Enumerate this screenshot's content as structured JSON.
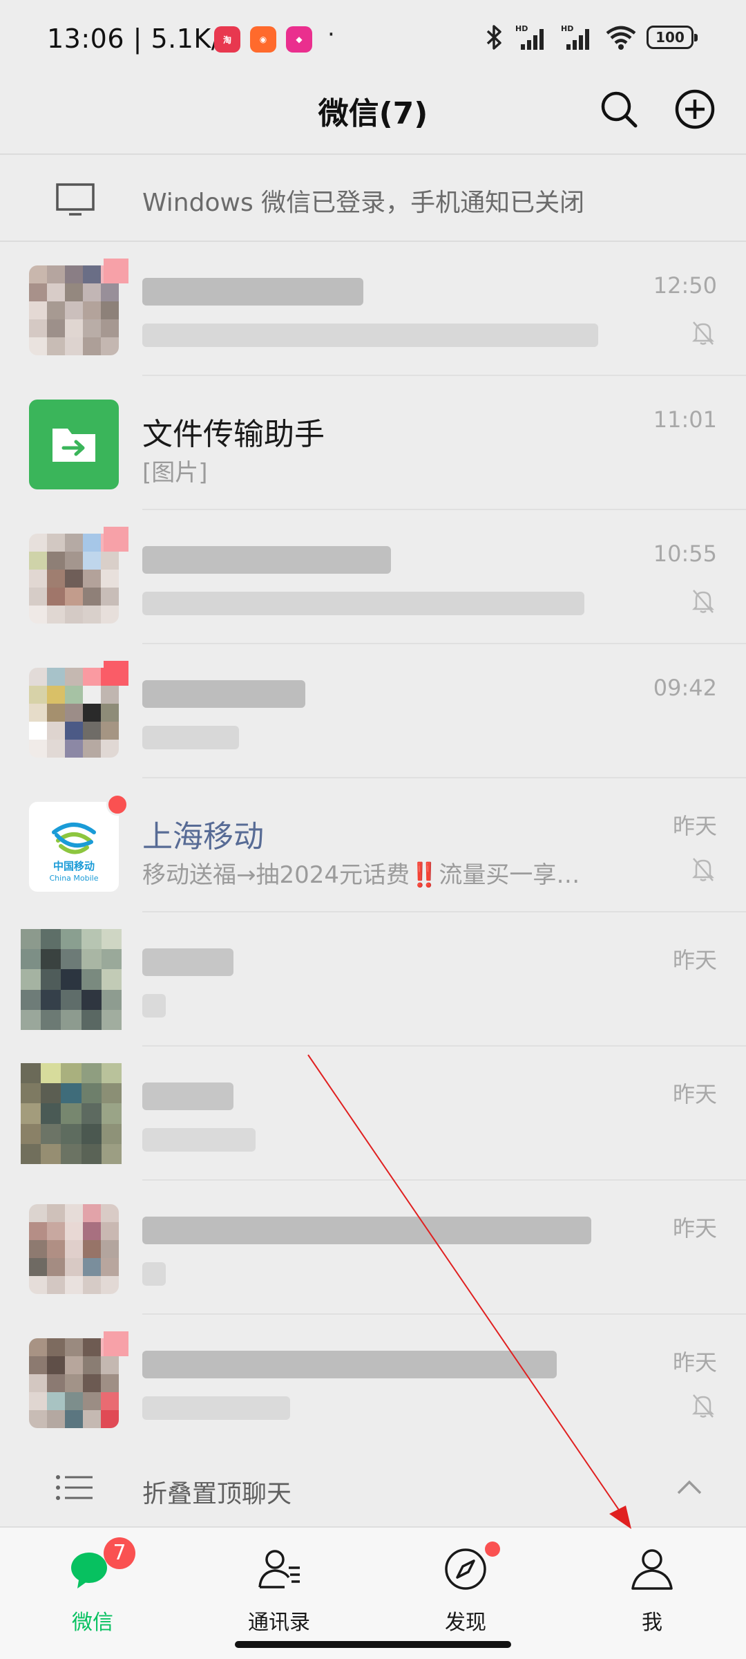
{
  "status_bar": {
    "time": "13:06 | 5.1K/s",
    "battery": "100",
    "signal_label_1": "HD",
    "signal_label_2": "HD"
  },
  "nav": {
    "title": "微信(7)"
  },
  "banner": {
    "text": "Windows 微信已登录，手机通知已关闭"
  },
  "chats": [
    {
      "name": "",
      "preview": "",
      "time": "12:50",
      "muted": true
    },
    {
      "name": "文件传输助手",
      "preview": "[图片]",
      "time": "11:01",
      "muted": false
    },
    {
      "name": "",
      "preview": "",
      "time": "10:55",
      "muted": true
    },
    {
      "name": "",
      "preview": "",
      "time": "09:42",
      "muted": false
    },
    {
      "name": "上海移动",
      "preview": "移动送福→抽2024元话费‼️流量买一享…",
      "time": "昨天",
      "muted": true,
      "avatar_text_1": "中国移动",
      "avatar_text_2": "China Mobile"
    },
    {
      "name": "",
      "preview": "",
      "time": "昨天",
      "muted": false
    },
    {
      "name": "",
      "preview": "",
      "time": "昨天",
      "muted": false
    },
    {
      "name": "",
      "preview": "",
      "time": "昨天",
      "muted": false
    },
    {
      "name": "",
      "preview": "",
      "time": "昨天",
      "muted": true
    }
  ],
  "fold": {
    "text": "折叠置顶聊天"
  },
  "tabs": [
    {
      "label": "微信",
      "badge": "7",
      "active": true
    },
    {
      "label": "通讯录",
      "active": false
    },
    {
      "label": "发现",
      "dot": true,
      "active": false
    },
    {
      "label": "我",
      "active": false
    }
  ],
  "colors": {
    "accent": "#07c160",
    "badge": "#fa5151",
    "link_name": "#576b95",
    "background": "#ededed"
  }
}
